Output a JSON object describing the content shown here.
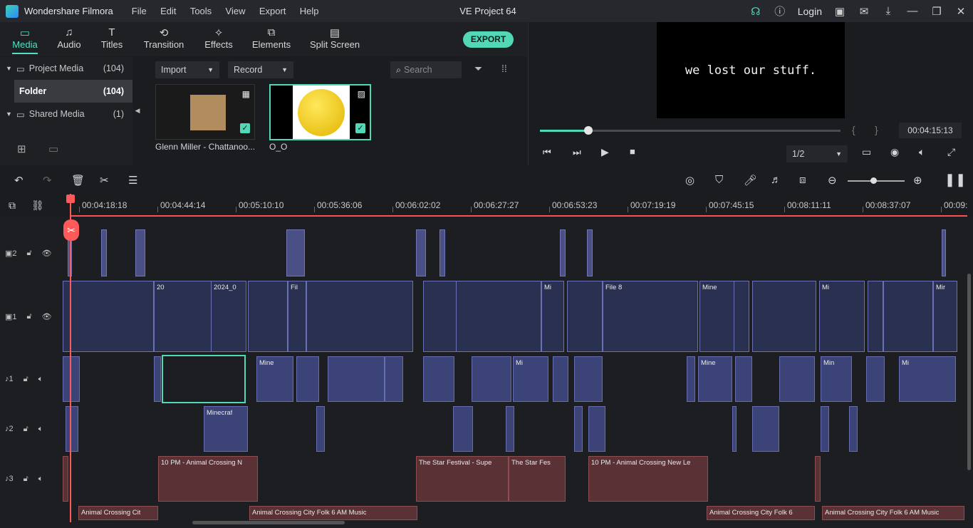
{
  "app": {
    "name": "Wondershare Filmora",
    "project": "VE Project 64",
    "login": "Login"
  },
  "menu": [
    "File",
    "Edit",
    "Tools",
    "View",
    "Export",
    "Help"
  ],
  "tabs": [
    {
      "label": "Media"
    },
    {
      "label": "Audio"
    },
    {
      "label": "Titles"
    },
    {
      "label": "Transition"
    },
    {
      "label": "Effects"
    },
    {
      "label": "Elements"
    },
    {
      "label": "Split Screen"
    }
  ],
  "export_label": "EXPORT",
  "library": [
    {
      "label": "Project Media",
      "count": "(104)"
    },
    {
      "label": "Folder",
      "count": "(104)"
    },
    {
      "label": "Shared Media",
      "count": "(1)"
    }
  ],
  "media_toolbar": {
    "import": "Import",
    "record": "Record",
    "search_placeholder": "Search"
  },
  "media_items": [
    {
      "name": "Glenn Miller - Chattanoo..."
    },
    {
      "name": "O_O"
    }
  ],
  "preview": {
    "screen_text": "we lost our stuff.",
    "timecode": "00:04:15:13",
    "quality": "1/2",
    "progress": 0.16
  },
  "ruler": [
    "00:04:18:18",
    "00:04:44:14",
    "00:05:10:10",
    "00:05:36:06",
    "00:06:02:02",
    "00:06:27:27",
    "00:06:53:23",
    "00:07:19:19",
    "00:07:45:15",
    "00:08:11:11",
    "00:08:37:07",
    "00:09:"
  ],
  "tracks": [
    {
      "id": "2",
      "type": "video"
    },
    {
      "id": "1",
      "type": "video"
    },
    {
      "id": "1",
      "type": "audio"
    },
    {
      "id": "2",
      "type": "audio"
    },
    {
      "id": "3",
      "type": "audio"
    }
  ],
  "clip_labels": {
    "v1": [
      "20",
      "2024_0",
      "Fil",
      "Mi",
      "File 8",
      "Mine",
      "Mi",
      "Mir"
    ],
    "a1": [
      "Mine",
      "Mi",
      "Mine",
      "Mi",
      "Min"
    ],
    "a2": [
      "Minecraf"
    ],
    "a3": [
      "10 PM - Animal Crossing N",
      "The Star Festival - Supe",
      "The Star Fes",
      "10 PM - Animal Crossing New Le"
    ],
    "a4": [
      "Animal Crossing Cit",
      "Animal Crossing City Folk 6 AM Music",
      "Animal Crossing City Folk 6",
      "Animal Crossing City Folk 6 AM Music"
    ]
  },
  "colors": {
    "accent": "#51d8b7",
    "playhead": "#ff5a5a"
  }
}
